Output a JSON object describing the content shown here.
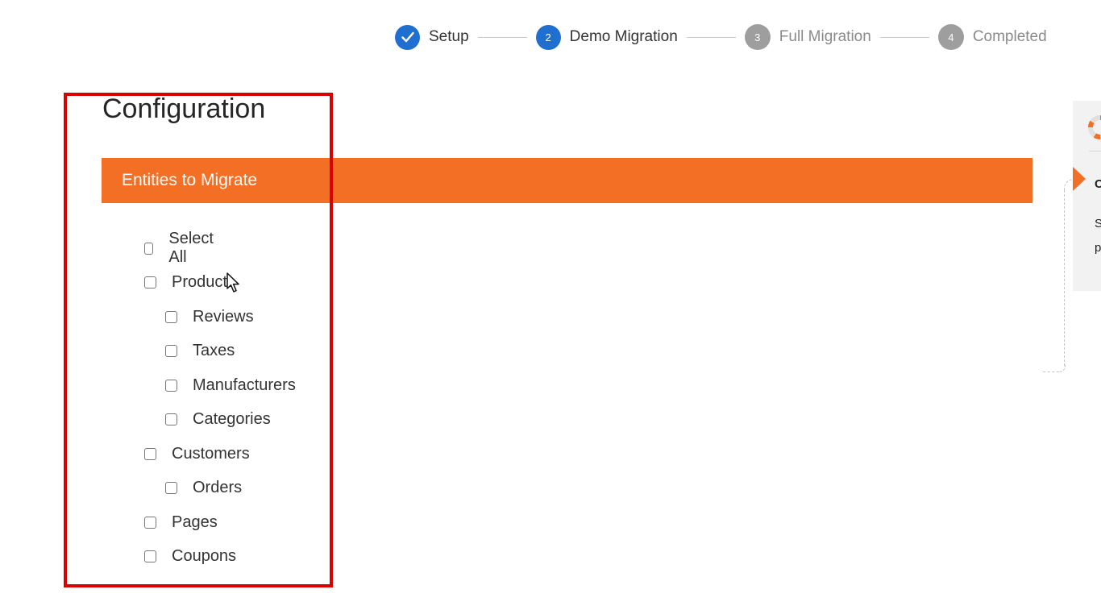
{
  "stepper": {
    "steps": [
      {
        "number": "",
        "label": "Setup",
        "state": "done"
      },
      {
        "number": "2",
        "label": "Demo Migration",
        "state": "active"
      },
      {
        "number": "3",
        "label": "Full Migration",
        "state": "pending"
      },
      {
        "number": "4",
        "label": "Completed",
        "state": "pending"
      }
    ]
  },
  "config": {
    "title": "Configuration",
    "section_title": "Entities to Migrate",
    "entities": [
      {
        "label": "Select All",
        "level": 0,
        "checked": false
      },
      {
        "label": "Products",
        "level": 0,
        "checked": false
      },
      {
        "label": "Reviews",
        "level": 1,
        "checked": false
      },
      {
        "label": "Taxes",
        "level": 1,
        "checked": false
      },
      {
        "label": "Manufacturers",
        "level": 1,
        "checked": false
      },
      {
        "label": "Categories",
        "level": 1,
        "checked": false
      },
      {
        "label": "Customers",
        "level": 0,
        "checked": false
      },
      {
        "label": "Orders",
        "level": 1,
        "checked": false
      },
      {
        "label": "Pages",
        "level": 0,
        "checked": false
      },
      {
        "label": "Coupons",
        "level": 0,
        "checked": false
      }
    ]
  },
  "side_panel": {
    "icon": "lifebuoy-icon",
    "heading_fragment": "C",
    "text_line_1": "S",
    "text_line_2": "p"
  },
  "colors": {
    "accent": "#f36f25",
    "step_active": "#1f6fd1",
    "step_pending": "#9e9e9e",
    "highlight": "#d90000"
  }
}
